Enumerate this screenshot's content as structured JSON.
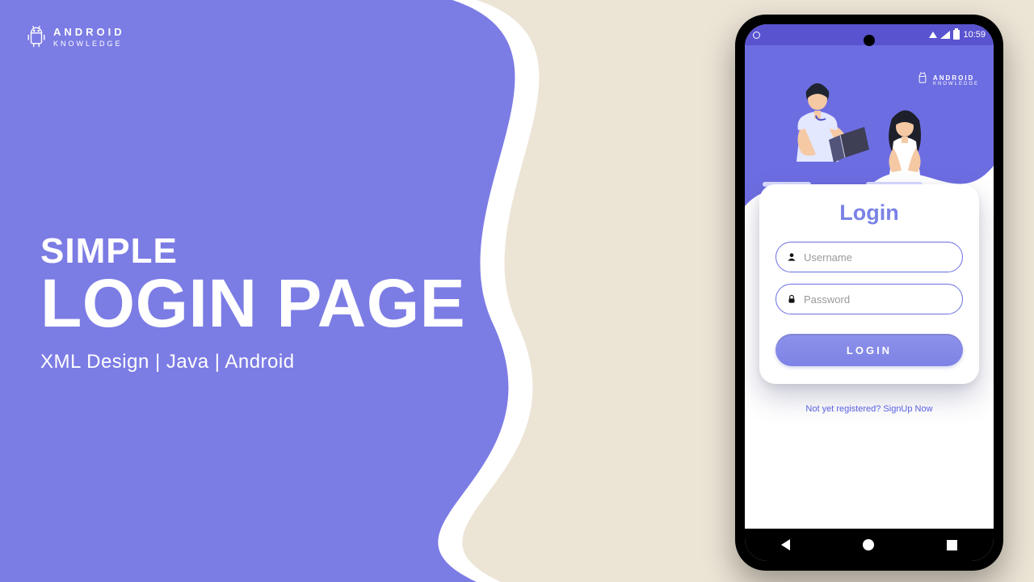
{
  "brand": {
    "line1": "ANDROID",
    "line2": "KNOWLEDGE"
  },
  "hero": {
    "simple": "SIMPLE",
    "main": "LOGIN PAGE",
    "sub": "XML Design | Java | Android"
  },
  "phone": {
    "status": {
      "time": "10:59"
    },
    "brand": {
      "line1": "ANDROID",
      "line2": "KNOWLEDGE"
    },
    "card": {
      "title": "Login",
      "username_placeholder": "Username",
      "password_placeholder": "Password",
      "login_button": "LOGIN"
    },
    "signup_text": "Not yet registered? SignUp Now"
  },
  "colors": {
    "accent": "#7c7ce5",
    "bg_right": "#ece4d5"
  }
}
